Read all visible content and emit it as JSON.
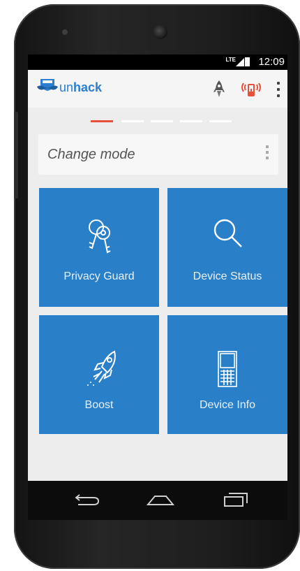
{
  "status_bar": {
    "network": "LTE",
    "time": "12:09"
  },
  "app_bar": {
    "brand_prefix": "un",
    "brand_suffix": "hack",
    "icons": [
      "mustache-shield-logo-icon",
      "rocket-icon",
      "alarm-device-icon",
      "more-vert-icon"
    ]
  },
  "pager": {
    "count": 5,
    "active_index": 0,
    "active_color": "#e8503a"
  },
  "mode_bar": {
    "label": "Change mode"
  },
  "tiles": [
    {
      "label": "Privacy Guard",
      "icon": "keys-icon"
    },
    {
      "label": "Device Status",
      "icon": "search-icon"
    },
    {
      "label": "Boost",
      "icon": "rocket-icon"
    },
    {
      "label": "Device Info",
      "icon": "phone-device-icon"
    }
  ],
  "nav_bar": {
    "icons": [
      "back-icon",
      "home-icon",
      "recents-icon"
    ]
  },
  "colors": {
    "accent": "#2a7fc9",
    "brand": "#2b7dd0",
    "alert": "#e8503a"
  }
}
